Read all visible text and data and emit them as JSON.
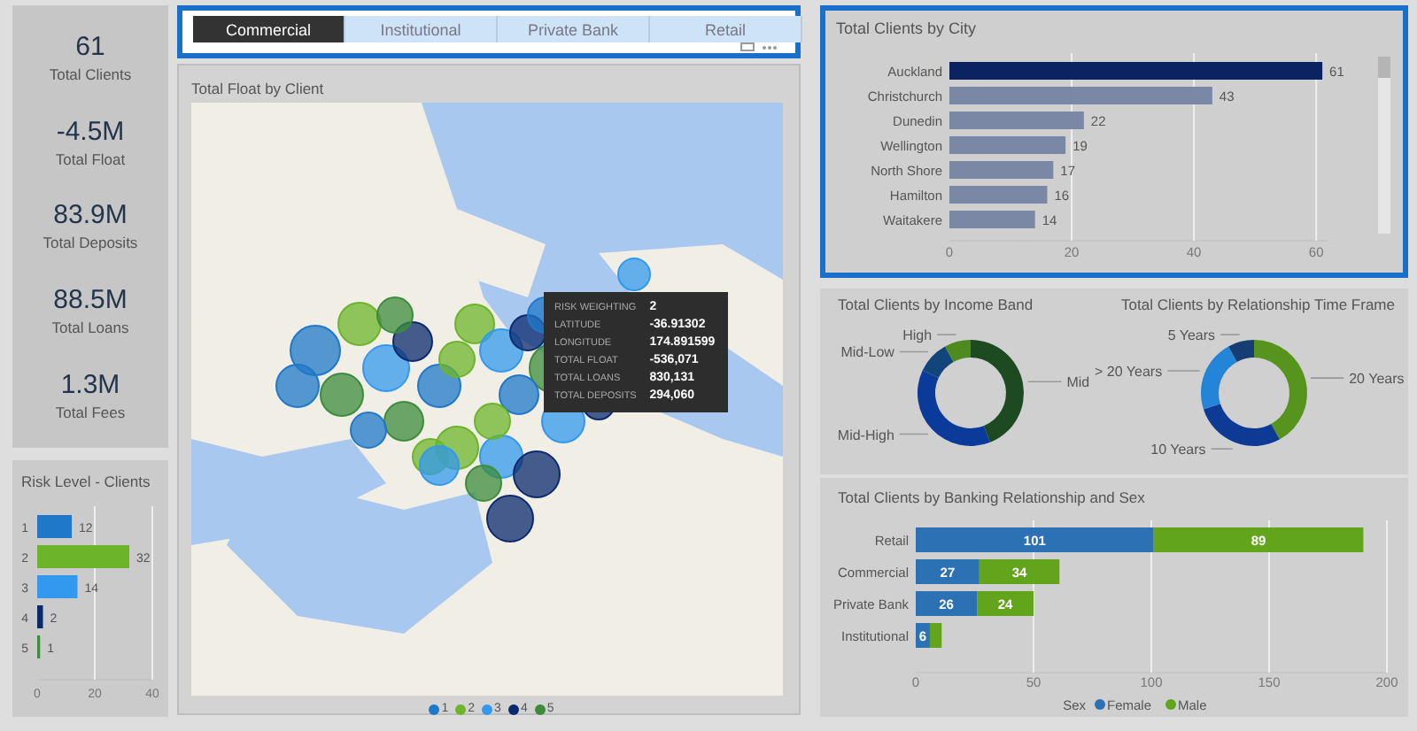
{
  "kpis": [
    {
      "value": "61",
      "label": "Total Clients"
    },
    {
      "value": "-4.5M",
      "label": "Total Float"
    },
    {
      "value": "83.9M",
      "label": "Total Deposits"
    },
    {
      "value": "88.5M",
      "label": "Total Loans"
    },
    {
      "value": "1.3M",
      "label": "Total Fees"
    }
  ],
  "risk_panel": {
    "chart_data": {
      "type": "bar",
      "orientation": "horizontal",
      "title": "Risk Level - Clients",
      "categories": [
        "1",
        "2",
        "3",
        "4",
        "5"
      ],
      "values": [
        12,
        32,
        14,
        2,
        1
      ],
      "colors": [
        "#1f78c8",
        "#6cb52a",
        "#3399ee",
        "#0b2a6e",
        "#3c8c3c"
      ],
      "xlim": [
        0,
        40
      ],
      "xticks": [
        0,
        20,
        40
      ],
      "grid": true,
      "value_labels": [
        "12",
        "32",
        "14",
        "2",
        "1"
      ]
    }
  },
  "tabs": [
    {
      "label": "Commercial",
      "selected": true
    },
    {
      "label": "Institutional",
      "selected": false
    },
    {
      "label": "Private Bank",
      "selected": false
    },
    {
      "label": "Retail",
      "selected": false
    }
  ],
  "map": {
    "title": "Total Float by Client",
    "tooltip": [
      {
        "label": "RISK WEIGHTING",
        "value": "2"
      },
      {
        "label": "LATITUDE",
        "value": "-36.91302"
      },
      {
        "label": "LONGITUDE",
        "value": "174.891599"
      },
      {
        "label": "TOTAL FLOAT",
        "value": "-536,071"
      },
      {
        "label": "TOTAL LOANS",
        "value": "830,131"
      },
      {
        "label": "TOTAL DEPOSITS",
        "value": "294,060"
      }
    ],
    "legend": [
      {
        "label": "1",
        "color": "#1f78c8"
      },
      {
        "label": "2",
        "color": "#6cb52a"
      },
      {
        "label": "3",
        "color": "#3399ee"
      },
      {
        "label": "4",
        "color": "#0b2a6e"
      },
      {
        "label": "5",
        "color": "#3c8c3c"
      }
    ]
  },
  "city_chart": {
    "chart_data": {
      "type": "bar",
      "orientation": "horizontal",
      "title": "Total Clients by City",
      "categories": [
        "Auckland",
        "Christchurch",
        "Dunedin",
        "Wellington",
        "North Shore",
        "Hamilton",
        "Waitakere"
      ],
      "values": [
        61,
        43,
        22,
        19,
        17,
        16,
        14
      ],
      "colors": [
        "#0b2461",
        "#7a88a6",
        "#7a88a6",
        "#7a88a6",
        "#7a88a6",
        "#7a88a6",
        "#7a88a6"
      ],
      "xlim": [
        0,
        62
      ],
      "xticks": [
        0,
        20,
        40,
        60
      ],
      "grid": true,
      "value_labels": [
        "61",
        "43",
        "22",
        "19",
        "17",
        "16",
        "14"
      ]
    }
  },
  "income_chart": {
    "chart_data": {
      "type": "donut",
      "title": "Total Clients by Income Band",
      "categories": [
        "Mid",
        "Mid-High",
        "Mid-Low",
        "High"
      ],
      "values": [
        44,
        38,
        10,
        8
      ],
      "colors": [
        "#1e4a22",
        "#0a3a9a",
        "#12467a",
        "#4e8a1e"
      ]
    }
  },
  "relationship_chart": {
    "chart_data": {
      "type": "donut",
      "title": "Total Clients by Relationship Time Frame",
      "categories": [
        "20 Years",
        "10 Years",
        "> 20 Years",
        "5 Years"
      ],
      "values": [
        42,
        28,
        22,
        8
      ],
      "colors": [
        "#56941e",
        "#0d3a94",
        "#2484d8",
        "#173d72"
      ]
    }
  },
  "banking_chart": {
    "chart_data": {
      "type": "bar",
      "orientation": "horizontal",
      "stacked": true,
      "title": "Total Clients by Banking Relationship and Sex",
      "categories": [
        "Retail",
        "Commercial",
        "Private Bank",
        "Institutional"
      ],
      "series": [
        {
          "name": "Female",
          "color": "#2b71b4",
          "values": [
            101,
            27,
            26,
            6
          ],
          "value_labels": [
            "101",
            "27",
            "26",
            "6"
          ]
        },
        {
          "name": "Male",
          "color": "#62a51c",
          "values": [
            89,
            34,
            24,
            5
          ],
          "value_labels": [
            "89",
            "34",
            "24",
            null
          ]
        }
      ],
      "xlim": [
        0,
        200
      ],
      "xticks": [
        0,
        50,
        100,
        150,
        200
      ],
      "grid": true,
      "legend": {
        "title": "Sex"
      }
    }
  }
}
